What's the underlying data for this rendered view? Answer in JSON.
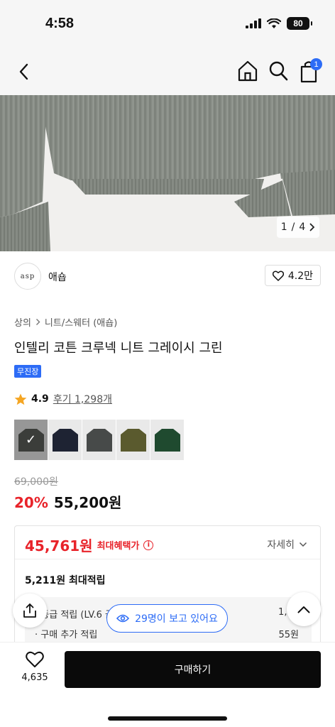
{
  "status": {
    "time": "4:58",
    "battery": "80"
  },
  "nav": {
    "cart_badge": "1"
  },
  "gallery": {
    "current": "1",
    "separator": "/",
    "total": "4"
  },
  "brand": {
    "logo_text": "asp",
    "name": "애숍",
    "likes": "4.2만"
  },
  "breadcrumb": {
    "level1": "상의",
    "level2": "니트/스웨터 (애숍)"
  },
  "product": {
    "title": "인텔리 코튼 크루넥 니트 그레이시 그린",
    "badge": "무진장",
    "rating": "4.9",
    "reviews": "후기 1,298개",
    "swatch_colors": [
      "#5b5e5a",
      "#1e2333",
      "#474a49",
      "#5a5a2e",
      "#1f4a2f"
    ],
    "original_price": "69,000원",
    "discount": "20%",
    "sale_price": "55,200원"
  },
  "benefit": {
    "amount": "45,761원",
    "label": "최대혜택가",
    "detail": "자세히",
    "max_points": "5,211원 최대적립",
    "row1_label": "· 등급 적립 (LV.6 골드",
    "row1_value": "1,65",
    "row2_label": "· 구매 추가 적립",
    "row2_value": "55원"
  },
  "viewers": "29명이 보고 있어요",
  "bottom": {
    "wish_count": "4,635",
    "buy_label": "구매하기"
  },
  "colors": {
    "accent": "#2d6cf6",
    "sale": "#e8232a",
    "knit": "#8a8f88"
  }
}
